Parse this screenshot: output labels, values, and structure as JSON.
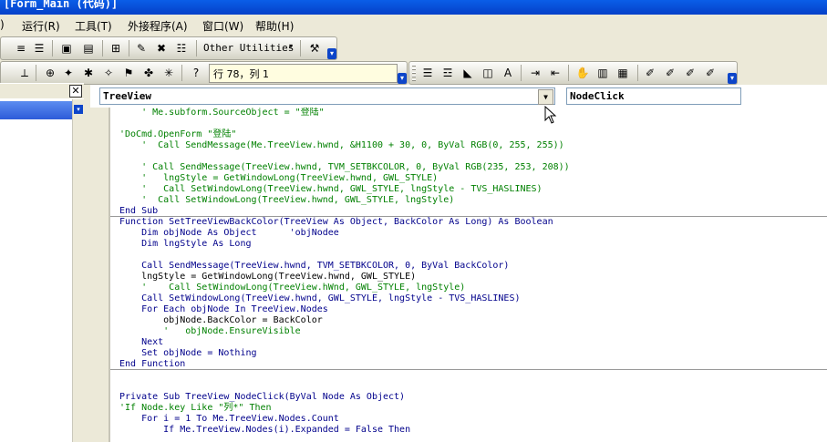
{
  "title": "[Form_Main (代码)]",
  "menu": [
    "运行(R)",
    "工具(T)",
    "外接程序(A)",
    "窗口(W)",
    "帮助(H)"
  ],
  "toolbar": {
    "other_utilities": "Other Utilities",
    "position": "行 78，列 1"
  },
  "code_window": {
    "object_combo": "TreeView",
    "procedure_combo": "NodeClick",
    "lines": [
      "    ' Me.subform.SourceObject = \"登陆\"",
      "",
      "'DoCmd.OpenForm \"登陆\"",
      "    '  Call SendMessage(Me.TreeView.hwnd, &H1100 + 30, 0, ByVal RGB(0, 255, 255))",
      "",
      "    ' Call SendMessage(TreeView.hwnd, TVM_SETBKCOLOR, 0, ByVal RGB(235, 253, 208))",
      "    '   lngStyle = GetWindowLong(TreeView.hwnd, GWL_STYLE)",
      "    '   Call SetWindowLong(TreeView.hwnd, GWL_STYLE, lngStyle - TVS_HASLINES)",
      "    '  Call SetWindowLong(TreeView.hwnd, GWL_STYLE, lngStyle)",
      "End Sub",
      "Function SetTreeViewBackColor(TreeView As Object, BackColor As Long) As Boolean",
      "    Dim objNode As Object      'objNodee",
      "    Dim lngStyle As Long",
      "",
      "    Call SendMessage(TreeView.hwnd, TVM_SETBKCOLOR, 0, ByVal BackColor)",
      "    lngStyle = GetWindowLong(TreeView.hwnd, GWL_STYLE)",
      "    '    Call SetWindowLong(TreeView.hWnd, GWL_STYLE, lngStyle)",
      "    Call SetWindowLong(TreeView.hwnd, GWL_STYLE, lngStyle - TVS_HASLINES)",
      "    For Each objNode In TreeView.Nodes",
      "        objNode.BackColor = BackColor",
      "        '   objNode.EnsureVisible",
      "    Next",
      "    Set objNode = Nothing",
      "End Function",
      "",
      "",
      "Private Sub TreeView_NodeClick(ByVal Node As Object)",
      "'If Node.key Like \"列*\" Then",
      "    For i = 1 To Me.TreeView.Nodes.Count",
      "        If Me.TreeView.Nodes(i).Expanded = False Then"
    ]
  }
}
